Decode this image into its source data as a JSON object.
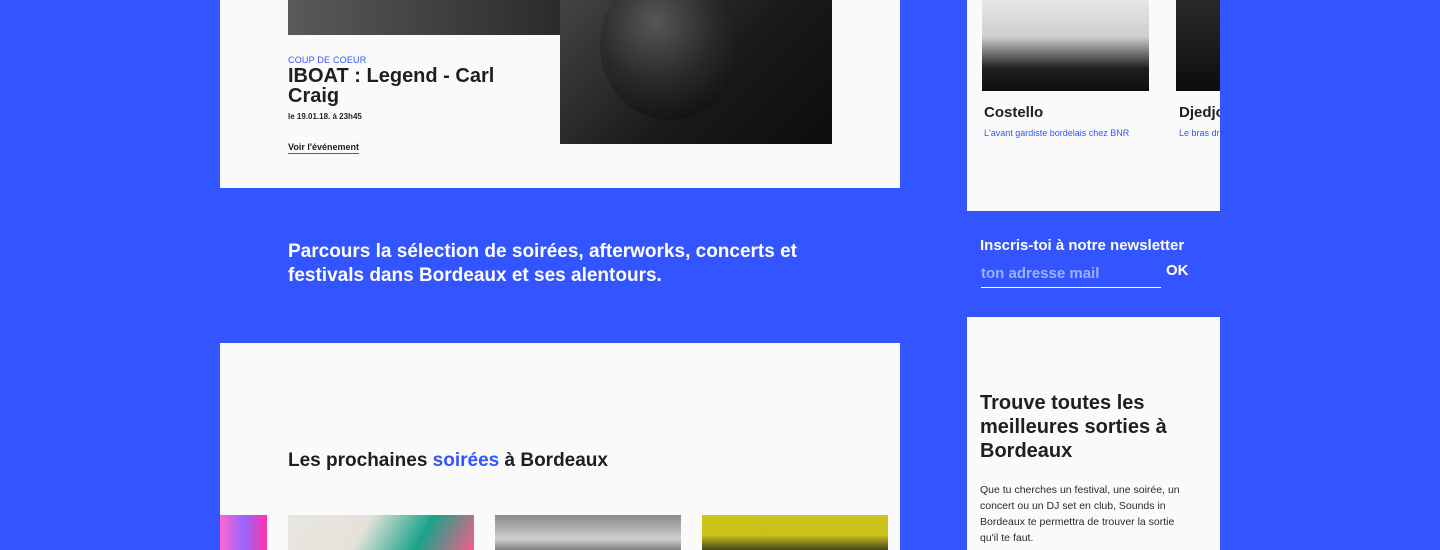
{
  "featured": {
    "label": "COUP DE COEUR",
    "title": "IBOAT : Legend - Carl Craig",
    "date": "le 19.01.18. à 23h45",
    "link_label": "Voir l'événement"
  },
  "intro": {
    "text": "Parcours la sélection de soirées, afterworks, concerts et festivals dans Bordeaux et ses alentours."
  },
  "upcoming": {
    "title_before": "Les prochaines ",
    "title_accent": "soirées",
    "title_after": " à Bordeaux"
  },
  "djs": [
    {
      "name": "Costello",
      "description": "L'avant gardiste bordelais chez BNR"
    },
    {
      "name": "Djedjo",
      "description": "Le bras dr"
    }
  ],
  "newsletter": {
    "title": "Inscris-toi à notre newsletter",
    "placeholder": "ton adresse mail",
    "button_label": "OK"
  },
  "sorties": {
    "title": "Trouve toutes les meilleures sorties à Bordeaux",
    "text": "Que tu cherches un festival, une soirée, un concert ou un DJ set en club, Sounds in Bordeaux te permettra de trouver la sortie qu'il te faut."
  },
  "colors": {
    "accent": "#3355ff",
    "background": "#3355ff",
    "card": "#fafafa",
    "text": "#1f1f1f"
  }
}
